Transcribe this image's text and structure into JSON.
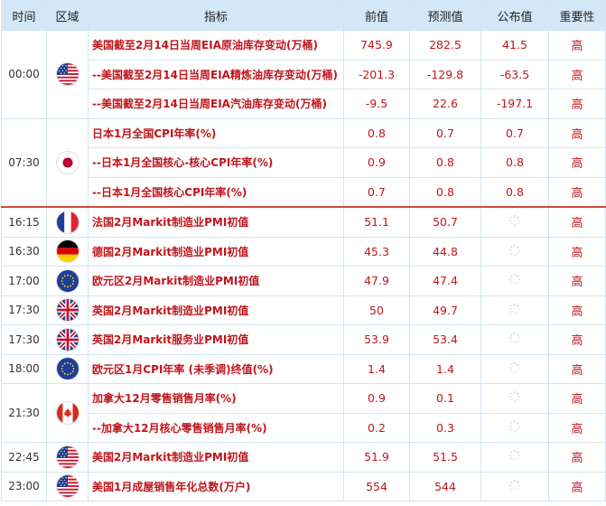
{
  "headers": {
    "time": "时间",
    "region": "区域",
    "indicator": "指标",
    "prev": "前值",
    "forecast": "预测值",
    "actual": "公布值",
    "importance": "重要性"
  },
  "groups": [
    {
      "time": "00:00",
      "flag": "us-flag-icon",
      "rows": [
        {
          "indicator": "美国截至2月14日当周EIA原油库存变动(万桶)",
          "prev": "745.9",
          "forecast": "282.5",
          "actual": "41.5",
          "importance": "高"
        },
        {
          "indicator": "--美国截至2月14日当周EIA精炼油库存变动(万桶)",
          "prev": "-201.3",
          "forecast": "-129.8",
          "actual": "-63.5",
          "importance": "高"
        },
        {
          "indicator": "--美国截至2月14日当周EIA汽油库存变动(万桶)",
          "prev": "-9.5",
          "forecast": "22.6",
          "actual": "-197.1",
          "importance": "高"
        }
      ]
    },
    {
      "time": "07:30",
      "flag": "japan-flag-icon",
      "rows": [
        {
          "indicator": "日本1月全国CPI年率(%)",
          "prev": "0.8",
          "forecast": "0.7",
          "actual": "0.7",
          "importance": "高"
        },
        {
          "indicator": "--日本1月全国核心-核心CPI年率(%)",
          "prev": "0.9",
          "forecast": "0.8",
          "actual": "0.8",
          "importance": "高"
        },
        {
          "indicator": "--日本1月全国核心CPI年率(%)",
          "prev": "0.7",
          "forecast": "0.8",
          "actual": "0.8",
          "importance": "高"
        }
      ]
    },
    {
      "time": "16:15",
      "flag": "france-flag-icon",
      "sep": true,
      "rows": [
        {
          "indicator": "法国2月Markit制造业PMI初值",
          "prev": "51.1",
          "forecast": "50.7",
          "actual": "",
          "importance": "高"
        }
      ]
    },
    {
      "time": "16:30",
      "flag": "germany-flag-icon",
      "rows": [
        {
          "indicator": "德国2月Markit制造业PMI初值",
          "prev": "45.3",
          "forecast": "44.8",
          "actual": "",
          "importance": "高"
        }
      ]
    },
    {
      "time": "17:00",
      "flag": "eu-flag-icon",
      "rows": [
        {
          "indicator": "欧元区2月Markit制造业PMI初值",
          "prev": "47.9",
          "forecast": "47.4",
          "actual": "",
          "importance": "高"
        }
      ]
    },
    {
      "time": "17:30",
      "flag": "uk-flag-icon",
      "rows": [
        {
          "indicator": "英国2月Markit制造业PMI初值",
          "prev": "50",
          "forecast": "49.7",
          "actual": "",
          "importance": "高"
        }
      ]
    },
    {
      "time": "17:30",
      "flag": "uk-flag-icon",
      "rows": [
        {
          "indicator": "英国2月Markit服务业PMI初值",
          "prev": "53.9",
          "forecast": "53.4",
          "actual": "",
          "importance": "高"
        }
      ]
    },
    {
      "time": "18:00",
      "flag": "eu-flag-icon",
      "rows": [
        {
          "indicator": "欧元区1月CPI年率 (未季调)终值(%)",
          "prev": "1.4",
          "forecast": "1.4",
          "actual": "",
          "importance": "高"
        }
      ]
    },
    {
      "time": "21:30",
      "flag": "canada-flag-icon",
      "rows": [
        {
          "indicator": "加拿大12月零售销售月率(%)",
          "prev": "0.9",
          "forecast": "0.1",
          "actual": "",
          "importance": "高"
        },
        {
          "indicator": "--加拿大12月核心零售销售月率(%)",
          "prev": "0.2",
          "forecast": "0.3",
          "actual": "",
          "importance": "高"
        }
      ]
    },
    {
      "time": "22:45",
      "flag": "us-flag-icon",
      "rows": [
        {
          "indicator": "美国2月Markit制造业PMI初值",
          "prev": "51.9",
          "forecast": "51.5",
          "actual": "",
          "importance": "高"
        }
      ]
    },
    {
      "time": "23:00",
      "flag": "us-flag-icon",
      "rows": [
        {
          "indicator": "美国1月成屋销售年化总数(万户)",
          "prev": "554",
          "forecast": "544",
          "actual": "",
          "importance": "高"
        }
      ]
    }
  ],
  "pending_icon": "loading-spinner-icon",
  "colors": {
    "header_bg": "#d3e7f7",
    "value_red": "#c0161c",
    "separator": "#cc4a3a"
  }
}
